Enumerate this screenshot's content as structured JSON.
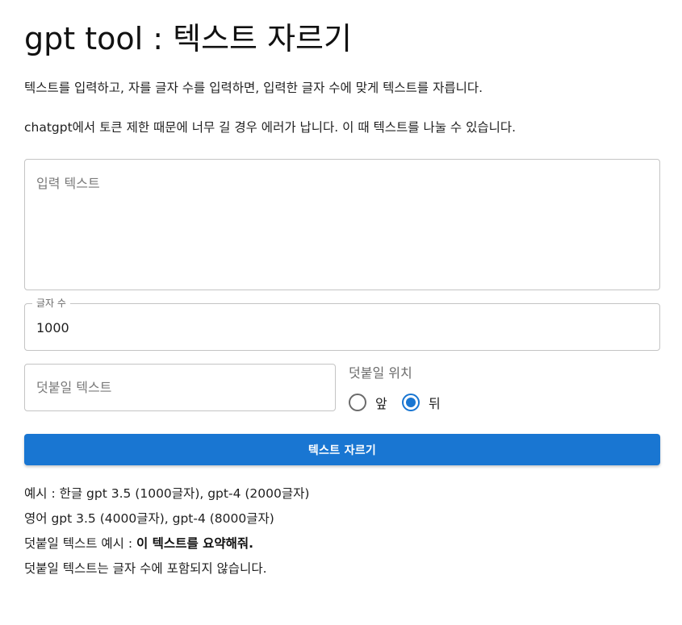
{
  "header": {
    "title": "gpt tool : 텍스트 자르기"
  },
  "description": {
    "line1": "텍스트를 입력하고, 자를 글자 수를 입력하면, 입력한 글자 수에 맞게 텍스트를 자릅니다.",
    "line2": "chatgpt에서 토큰 제한 때문에 너무 길 경우 에러가 납니다. 이 때 텍스트를 나눌 수 있습니다."
  },
  "form": {
    "input_text": {
      "placeholder": "입력 텍스트",
      "value": ""
    },
    "char_count": {
      "label": "글자 수",
      "value": "1000"
    },
    "append_text": {
      "placeholder": "덧붙일 텍스트",
      "value": ""
    },
    "append_position": {
      "label": "덧붙일 위치",
      "options": [
        "앞",
        "뒤"
      ],
      "selected": "뒤"
    },
    "submit_label": "텍스트 자르기"
  },
  "notes": {
    "line1": "예시 : 한글 gpt 3.5 (1000글자), gpt-4 (2000글자)",
    "line2": "영어 gpt 3.5 (4000글자), gpt-4 (8000글자)",
    "line3_prefix": "덧붙일 텍스트 예시 : ",
    "line3_bold": "이 텍스트를 요약해줘.",
    "line4": "덧붙일 텍스트는 글자 수에 포함되지 않습니다."
  },
  "colors": {
    "primary": "#1976d2",
    "border": "#c4c4c4",
    "muted_text": "#6b6b6b"
  }
}
